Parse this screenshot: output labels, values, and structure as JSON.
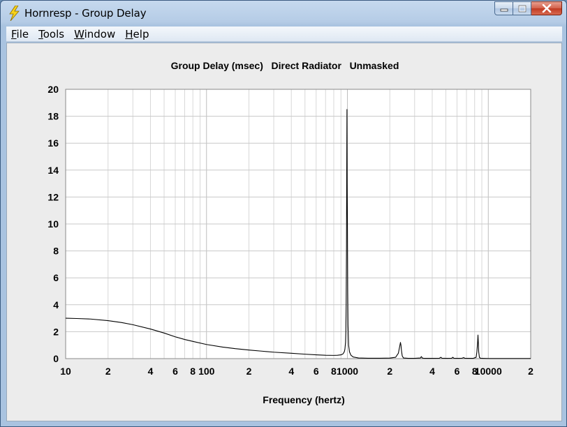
{
  "window": {
    "title": "Hornresp - Group Delay",
    "controls": {
      "minimize": "minimize",
      "maximize": "maximize",
      "close": "close"
    }
  },
  "menu": {
    "items": [
      {
        "label": "File",
        "accel": "F",
        "rest": "ile"
      },
      {
        "label": "Tools",
        "accel": "T",
        "rest": "ools"
      },
      {
        "label": "Window",
        "accel": "W",
        "rest": "indow"
      },
      {
        "label": "Help",
        "accel": "H",
        "rest": "elp"
      }
    ]
  },
  "icons": {
    "app": "lightning-bolt-icon"
  },
  "chart_data": {
    "type": "line",
    "title": "Group Delay (msec)   Direct Radiator   Unmasked",
    "xlabel": "Frequency (hertz)",
    "ylabel": "",
    "xscale": "log",
    "xlim": [
      10,
      20000
    ],
    "ylim": [
      0,
      20
    ],
    "yticks": [
      0,
      2,
      4,
      6,
      8,
      10,
      12,
      14,
      16,
      18,
      20
    ],
    "xtick_labels": [
      {
        "value": 10,
        "label": "10"
      },
      {
        "value": 20,
        "label": "2"
      },
      {
        "value": 40,
        "label": "4"
      },
      {
        "value": 60,
        "label": "6"
      },
      {
        "value": 80,
        "label": "8"
      },
      {
        "value": 100,
        "label": "100"
      },
      {
        "value": 200,
        "label": "2"
      },
      {
        "value": 400,
        "label": "4"
      },
      {
        "value": 600,
        "label": "6"
      },
      {
        "value": 800,
        "label": "8"
      },
      {
        "value": 1000,
        "label": "1000"
      },
      {
        "value": 2000,
        "label": "2"
      },
      {
        "value": 4000,
        "label": "4"
      },
      {
        "value": 6000,
        "label": "6"
      },
      {
        "value": 8000,
        "label": "8"
      },
      {
        "value": 10000,
        "label": "10000"
      },
      {
        "value": 20000,
        "label": "2"
      }
    ],
    "grid": true,
    "line_color": "#000000",
    "series": [
      {
        "x": [
          10,
          12,
          15,
          20,
          25,
          30,
          40,
          50,
          60,
          70,
          80,
          100,
          130,
          160,
          200,
          250,
          300,
          400,
          500,
          600,
          700,
          800,
          850,
          900,
          930,
          950,
          960,
          970,
          975,
          980,
          985,
          990,
          993,
          996,
          1000,
          1005,
          1010,
          1020,
          1035,
          1060,
          1100,
          1200,
          1400,
          1700,
          2000,
          2200,
          2300,
          2350,
          2380,
          2400,
          2420,
          2450,
          2500,
          2700,
          3000,
          3300,
          3350,
          3400,
          3500,
          4000,
          4500,
          4600,
          4700,
          5000,
          5500,
          5600,
          5700,
          6000,
          6500,
          6700,
          6800,
          7000,
          7800,
          8200,
          8300,
          8400,
          8450,
          8500,
          8550,
          8650,
          8800,
          9000,
          10000,
          13000,
          16000,
          20000
        ],
        "y": [
          3.0,
          2.98,
          2.94,
          2.82,
          2.68,
          2.52,
          2.2,
          1.9,
          1.62,
          1.42,
          1.28,
          1.05,
          0.86,
          0.74,
          0.64,
          0.55,
          0.48,
          0.4,
          0.33,
          0.28,
          0.25,
          0.24,
          0.25,
          0.28,
          0.35,
          0.5,
          0.7,
          1.2,
          2.0,
          4.0,
          8.0,
          15.0,
          18.5,
          13.0,
          10.5,
          5.0,
          2.5,
          1.0,
          0.5,
          0.25,
          0.12,
          0.05,
          0.03,
          0.03,
          0.04,
          0.1,
          0.4,
          0.9,
          1.2,
          1.0,
          0.6,
          0.2,
          0.05,
          0.02,
          0.02,
          0.05,
          0.15,
          0.05,
          0.02,
          0.02,
          0.03,
          0.1,
          0.03,
          0.02,
          0.03,
          0.1,
          0.03,
          0.02,
          0.03,
          0.08,
          0.03,
          0.02,
          0.02,
          0.1,
          0.5,
          1.2,
          1.75,
          1.2,
          0.5,
          0.1,
          0.03,
          0.02,
          0.01,
          0.01,
          0.01,
          0.01
        ]
      }
    ]
  }
}
